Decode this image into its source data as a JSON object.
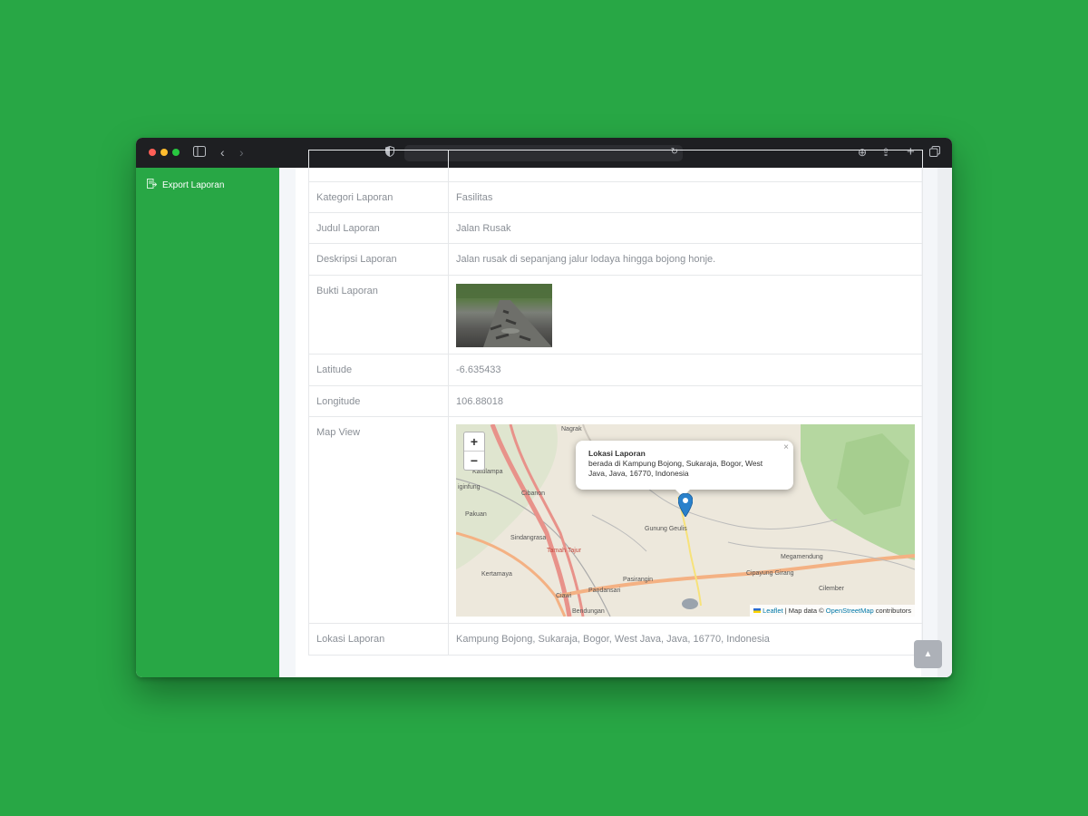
{
  "sidebar": {
    "items": [
      {
        "label": "Export Laporan",
        "icon": "export-file-icon"
      }
    ]
  },
  "details": {
    "rows": [
      {
        "label": "Kategori Laporan",
        "value": "Fasilitas"
      },
      {
        "label": "Judul Laporan",
        "value": "Jalan Rusak"
      },
      {
        "label": "Deskripsi Laporan",
        "value": "Jalan rusak di sepanjang jalur lodaya hingga bojong honje."
      },
      {
        "label": "Bukti Laporan",
        "value": ""
      },
      {
        "label": "Latitude",
        "value": "-6.635433"
      },
      {
        "label": "Longitude",
        "value": "106.88018"
      },
      {
        "label": "Map View",
        "value": ""
      },
      {
        "label": "Lokasi Laporan",
        "value": "Kampung Bojong, Sukaraja, Bogor, West Java, Java, 16770, Indonesia"
      }
    ]
  },
  "map": {
    "zoom_in": "+",
    "zoom_out": "−",
    "popup_title": "Lokasi Laporan",
    "popup_text": "berada di Kampung Bojong, Sukaraja, Bogor, West Java, Java, 16770, Indonesia",
    "popup_close": "×",
    "attribution": {
      "leaflet": "Leaflet",
      "middle": " | Map data © ",
      "osm": "OpenStreetMap",
      "tail": " contributors"
    },
    "place_labels": {
      "nagrak": "Nagrak",
      "katulampa": "Katulampa",
      "ciri": "iginfung",
      "ciblanon": "Cibanon",
      "pakuan": "Pakuan",
      "sindangrasa": "Sindangrasa",
      "tajur": "Tamah Tajur",
      "kertamaya": "Kertamaya",
      "gununggeulis": "Gunung Geulis",
      "pasirangin": "Pasirangin",
      "pandansari": "Pandansari",
      "megamendung": "Megamendung",
      "cipayung": "Cipayung Girang",
      "cilember": "Cilember",
      "ciawi": "Ciawi",
      "bendungan": "Bendungan"
    }
  },
  "colors": {
    "brand": "#28a745",
    "background": "#28a745"
  }
}
